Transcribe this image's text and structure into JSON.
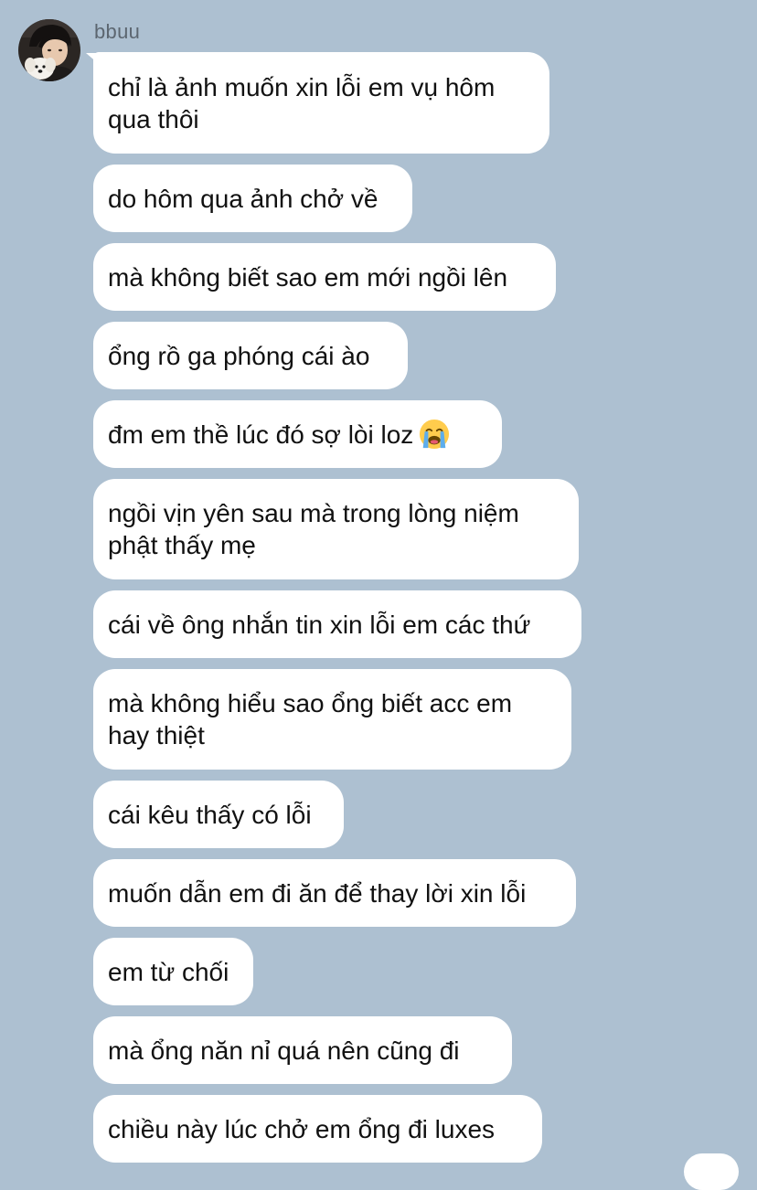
{
  "sender": {
    "name": "bbuu",
    "avatar_icon": "profile-photo-person-with-white-dog"
  },
  "colors": {
    "background": "#adc0d1",
    "bubble": "#ffffff",
    "text": "#111111",
    "sender_name": "#5c6670"
  },
  "messages": [
    {
      "text": "chỉ là ảnh muốn xin lỗi em vụ hôm\nqua thôi"
    },
    {
      "text": "do hôm qua ảnh chở về"
    },
    {
      "text": "mà không biết sao em mới ngồi lên"
    },
    {
      "text": "ổng rồ ga phóng cái ào"
    },
    {
      "text": "đm em thề lúc đó sợ lòi loz",
      "emoji": "loudly-crying-face-icon"
    },
    {
      "text": "ngồi vịn yên sau mà trong lòng niệm\nphật thấy mẹ"
    },
    {
      "text": "cái về ông nhắn tin xin lỗi em các thứ"
    },
    {
      "text": "mà không hiểu sao ổng biết acc em\nhay thiệt"
    },
    {
      "text": "cái kêu thấy có lỗi"
    },
    {
      "text": "muốn dẫn em đi ăn để thay lời xin lỗi"
    },
    {
      "text": "em từ chối"
    },
    {
      "text": "mà ổng năn nỉ quá nên cũng đi"
    },
    {
      "text": "chiều này lúc chở em ổng đi luxes"
    }
  ]
}
